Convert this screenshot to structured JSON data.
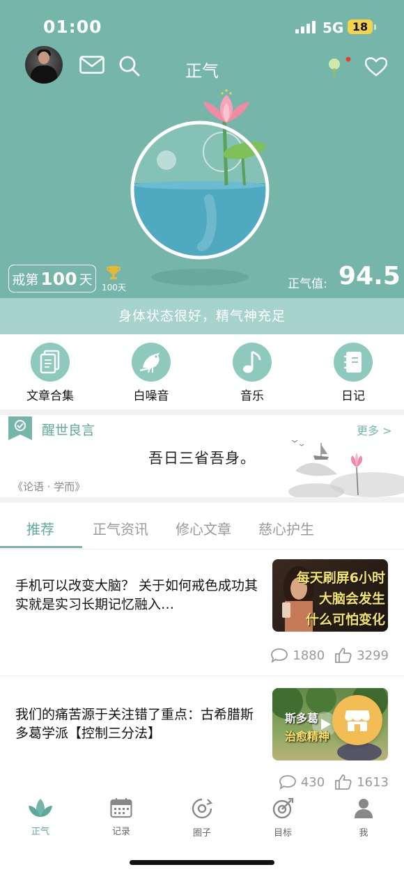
{
  "status_bar": {
    "time": "01:00",
    "network": "5G",
    "battery": "18"
  },
  "header": {
    "title": "正气"
  },
  "hero": {
    "days_prefix": "戒第",
    "days_count": "100",
    "days_suffix": "天",
    "trophy_label": "100天",
    "zhengqi_label": "正气值:",
    "zhengqi_value": "94.5",
    "state_text": "身体状态很好，精气神充足"
  },
  "quick_actions": [
    {
      "label": "文章合集",
      "icon": "document-icon"
    },
    {
      "label": "白噪音",
      "icon": "bird-icon"
    },
    {
      "label": "音乐",
      "icon": "music-note-icon"
    },
    {
      "label": "日记",
      "icon": "notebook-icon"
    }
  ],
  "quote": {
    "section_title": "醒世良言",
    "more_label": "更多 >",
    "text": "吾日三省吾身。",
    "source": "《论语 · 学而》"
  },
  "tabs": [
    {
      "label": "推荐",
      "active": true
    },
    {
      "label": "正气资讯",
      "active": false
    },
    {
      "label": "修心文章",
      "active": false
    },
    {
      "label": "慈心护生",
      "active": false
    }
  ],
  "articles": [
    {
      "title": "手机可以改变大脑？ 关于如何戒色成功其实就是实习长期记忆融入…",
      "thumb_lines": [
        "每天刷屏6小时",
        "大脑会发生",
        "什么可怕变化"
      ],
      "comments": "1880",
      "likes": "3299"
    },
    {
      "title": "我们的痛苦源于关注错了重点：古希腊斯多葛学派【控制三分法】",
      "thumb_lines": [
        "斯多葛",
        "治愈精神"
      ],
      "comments": "430",
      "likes": "1613"
    }
  ],
  "bottom_nav": [
    {
      "label": "正气",
      "icon": "lotus-icon",
      "active": true
    },
    {
      "label": "记录",
      "icon": "calendar-icon",
      "active": false
    },
    {
      "label": "圈子",
      "icon": "circle-refresh-icon",
      "active": false
    },
    {
      "label": "目标",
      "icon": "target-icon",
      "active": false
    },
    {
      "label": "我",
      "icon": "person-icon",
      "active": false
    }
  ],
  "colors": {
    "primary": "#76b6aa",
    "accent": "#5fa99c",
    "light": "#a6d4cb"
  }
}
